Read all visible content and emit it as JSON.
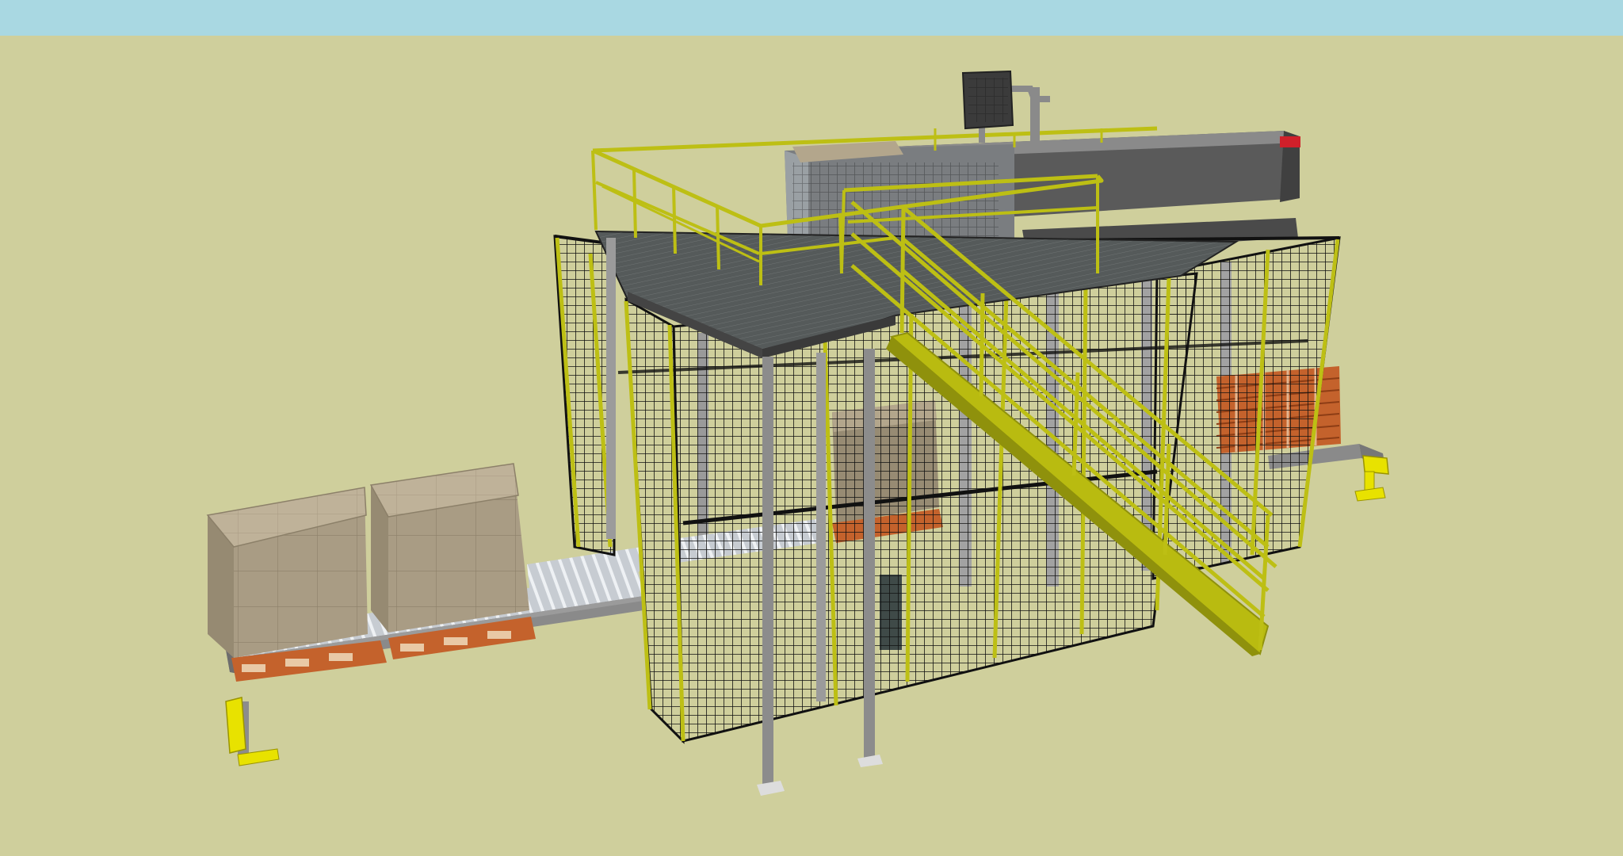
{
  "viewport": {
    "type": "3d-model-view",
    "sky_color": "#a9d8e2",
    "ground_color": "#cfcf9c"
  },
  "colors": {
    "safety_yellow": "#bdbf14",
    "yellow_dark": "#8f910c",
    "fence_black": "#111111",
    "steel_grey": "#8e8e8e",
    "platform_grey": "#4e5252",
    "machine_dark": "#555555",
    "cardboard": "#b3a68c",
    "pallet_orange": "#c4622c",
    "warning_red": "#d0202a"
  },
  "scene_objects": {
    "infeed_conveyor": "roller-conveyor",
    "pallet_loads": "stacked-cardboard-boxes",
    "safety_fence": "wire-mesh-fence",
    "platform": "steel-mezzanine-platform",
    "handrail": "yellow-handrail",
    "staircase": "yellow-access-stairs",
    "robot_machine": "palletizer-machine",
    "operator_monitor": "hmi-monitor",
    "pallet_stack": "empty-pallet-magazine"
  }
}
